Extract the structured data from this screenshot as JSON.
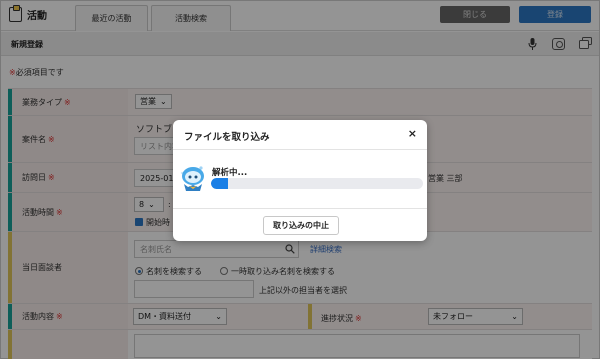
{
  "app": {
    "title": "活動"
  },
  "tabs": [
    {
      "label": "最近の活動"
    },
    {
      "label": "活動検索"
    }
  ],
  "toolbar": {
    "close_label": "閉じる",
    "register_label": "登録"
  },
  "form": {
    "title": "新規登録",
    "required_note_mark": "※",
    "required_note": "必須項目です",
    "required_mark": "※",
    "rows": {
      "business_type": {
        "label": "業務タイプ",
        "value": "営業"
      },
      "subject": {
        "label": "案件名",
        "value": "ソフトブレーン展示会 デモ実施の",
        "placeholder": "リスト内容"
      },
      "visit_date": {
        "label": "訪問日",
        "value": "2025-01",
        "person": "営業 三部"
      },
      "activity_time": {
        "label": "活動時間",
        "hour": "8",
        "separator": ":",
        "checkbox_label": "開始時"
      },
      "attendee": {
        "label": "当日面談者",
        "search_placeholder": "名刺氏名",
        "detail_link": "詳細検索",
        "radio_options": [
          "名刺を検索する",
          "一時取り込み名刺を検索する"
        ],
        "other_label": "上記以外の担当者を選択"
      },
      "activity_content": {
        "label": "活動内容",
        "value": "DM・資料送付"
      },
      "progress_status": {
        "label": "進捗状況",
        "value": "未フォロー"
      }
    }
  },
  "modal": {
    "title": "ファイルを取り込み",
    "close_symbol": "×",
    "status_text": "解析中...",
    "progress": 0.08,
    "progress_color": "#1a7fe6",
    "cancel_label": "取り込みの中止"
  },
  "colors": {
    "accent": "#2b78c5",
    "required_bar": "#17a39a",
    "optional_bar": "#e0c65a",
    "required_text": "#dd3333"
  }
}
